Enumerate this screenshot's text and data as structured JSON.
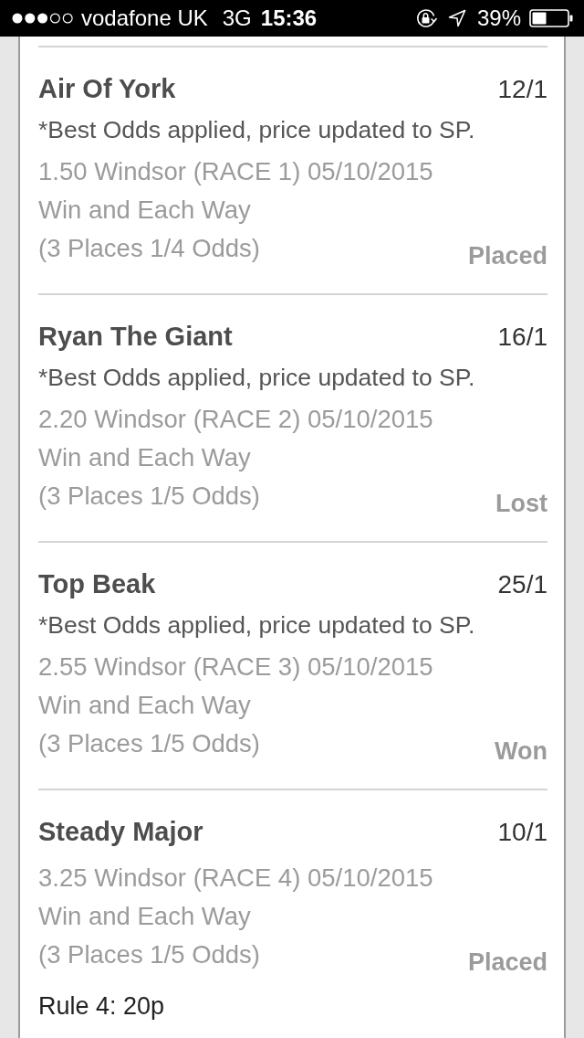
{
  "status_bar": {
    "carrier": "vodafone UK",
    "network": "3G",
    "time": "15:36",
    "battery": "39%"
  },
  "legs": [
    {
      "name": "Air Of York",
      "odds": "12/1",
      "note": "*Best Odds applied, price updated to SP.",
      "race": "1.50 Windsor (RACE 1) 05/10/2015",
      "bet_type": "Win and Each Way",
      "terms": "(3 Places 1/4 Odds)",
      "result": "Placed"
    },
    {
      "name": "Ryan The Giant",
      "odds": "16/1",
      "note": "*Best Odds applied, price updated to SP.",
      "race": "2.20 Windsor (RACE 2) 05/10/2015",
      "bet_type": "Win and Each Way",
      "terms": "(3 Places 1/5 Odds)",
      "result": "Lost"
    },
    {
      "name": "Top Beak",
      "odds": "25/1",
      "note": "*Best Odds applied, price updated to SP.",
      "race": "2.55 Windsor (RACE 3) 05/10/2015",
      "bet_type": "Win and Each Way",
      "terms": "(3 Places 1/5 Odds)",
      "result": "Won"
    },
    {
      "name": "Steady Major",
      "odds": "10/1",
      "race": "3.25 Windsor (RACE 4) 05/10/2015",
      "bet_type": "Win and Each Way",
      "terms": "(3 Places 1/5 Odds)",
      "result": "Placed",
      "rule_4": "Rule 4: 20p"
    }
  ]
}
